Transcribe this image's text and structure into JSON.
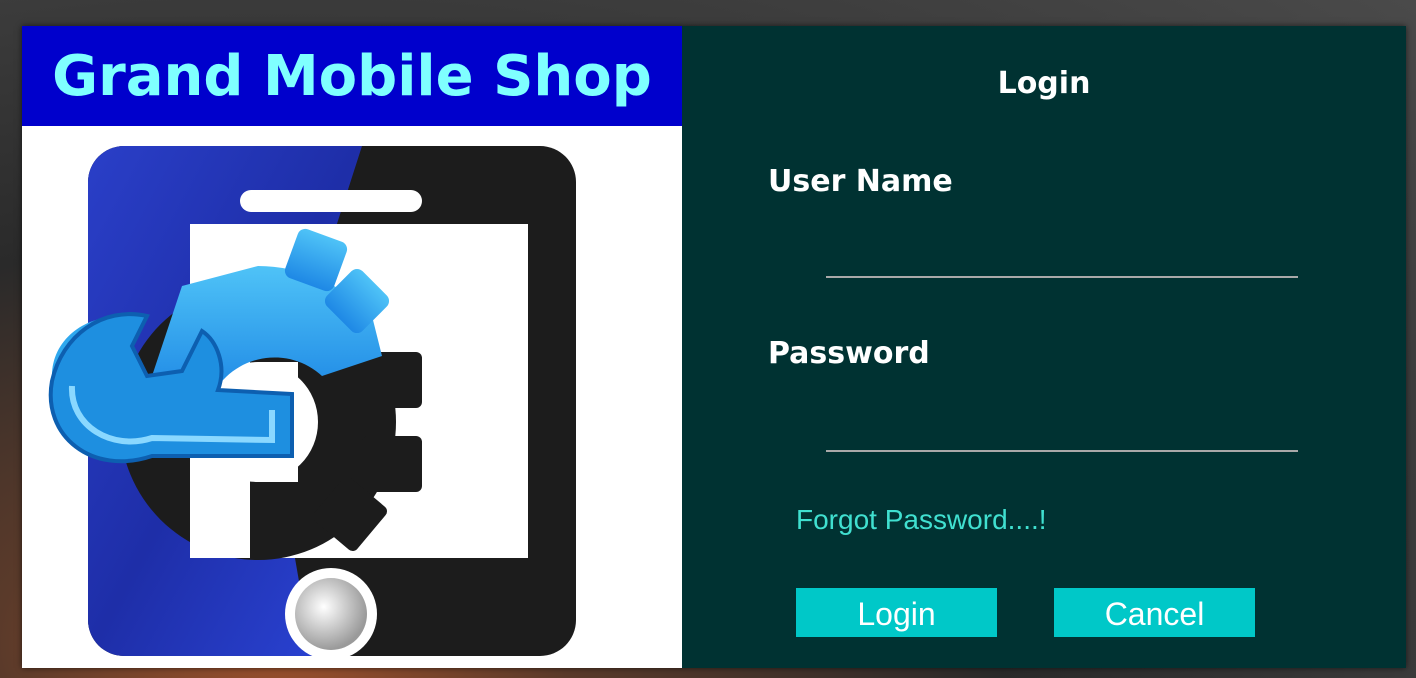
{
  "brand": {
    "title": "Grand Mobile Shop",
    "logo_icon": "phone-repair-icon",
    "header_color": "#0000cc",
    "title_color": "#7fffff"
  },
  "login": {
    "title": "Login",
    "username_label": "User Name",
    "username_value": "",
    "password_label": "Password",
    "password_value": "",
    "forgot_link": "Forgot Password....!",
    "login_button": "Login",
    "cancel_button": "Cancel",
    "panel_color": "#003232",
    "button_color": "#00c8c8",
    "link_color": "#40e0d0"
  }
}
